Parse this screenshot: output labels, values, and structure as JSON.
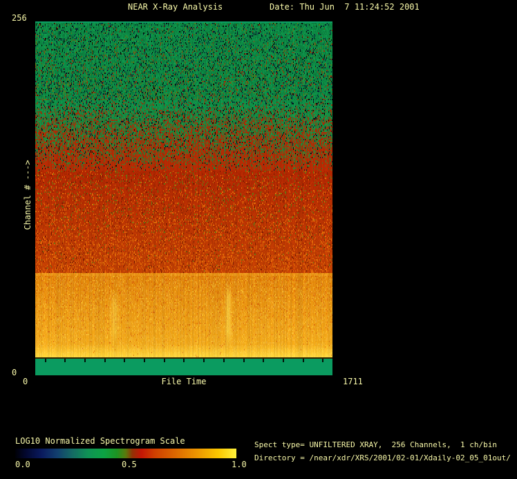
{
  "header": {
    "title": "NEAR X-Ray Analysis",
    "date_label": "Date: Thu Jun  7 11:24:52 2001"
  },
  "axes": {
    "y_max_label": "256",
    "y_min_label": "0",
    "y_axis_label": "Channel # --->",
    "x_min_label": "0",
    "x_max_label": "1711",
    "x_axis_label": "File Time"
  },
  "colorbar": {
    "title": "LOG10 Normalized Spectrogram Scale",
    "tick_labels": [
      "0.0",
      "0.5",
      "1.0"
    ],
    "gradient_stops": [
      {
        "pos": 0.0,
        "color": "#000006"
      },
      {
        "pos": 0.05,
        "color": "#030830"
      },
      {
        "pos": 0.12,
        "color": "#0a1a5e"
      },
      {
        "pos": 0.19,
        "color": "#123f6e"
      },
      {
        "pos": 0.26,
        "color": "#146b63"
      },
      {
        "pos": 0.33,
        "color": "#0f9355"
      },
      {
        "pos": 0.4,
        "color": "#0ca344"
      },
      {
        "pos": 0.46,
        "color": "#1d9422"
      },
      {
        "pos": 0.5,
        "color": "#5a7a0c"
      },
      {
        "pos": 0.53,
        "color": "#933105"
      },
      {
        "pos": 0.57,
        "color": "#c41605"
      },
      {
        "pos": 0.63,
        "color": "#cf3f00"
      },
      {
        "pos": 0.72,
        "color": "#dc6600"
      },
      {
        "pos": 0.82,
        "color": "#ec9500"
      },
      {
        "pos": 0.92,
        "color": "#fbc800"
      },
      {
        "pos": 1.0,
        "color": "#fff23c"
      }
    ]
  },
  "info": {
    "spect_type_line": "Spect type= UNFILTERED XRAY,  256 Channels,  1 ch/bin",
    "directory_line": "Directory = /near/xdr/XRS/2001/02-01/Xdaily-02_05_01out/"
  },
  "colors": {
    "background": "#000000",
    "text": "#f9f9aa"
  },
  "spectrogram_palette": {
    "top_edge": "#0c9e64",
    "green_base": "#0f9a4e",
    "green_dark": "#0a6e35",
    "speck_navy": "#071c38",
    "speck_black": "#041008",
    "speck_red_dim": "#96300a",
    "olive": "#637612",
    "red_base": "#bc2a02",
    "red_bright": "#cc4404",
    "red_dark": "#7c1e02",
    "orange_speck": "#e06a08",
    "boundary_orange": "#f0a428",
    "orange_top": "#e08408",
    "orange_bottom": "#f2ae1c",
    "yellow_edge": "#ffd63c",
    "streak_yellow": "#ffe050",
    "dark_line": "#2e2400",
    "bottom_green": "#0b9b60",
    "tick_black": "#021008"
  },
  "chart_data": {
    "type": "heatmap",
    "title": "NEAR X-Ray Analysis",
    "xlabel": "File Time",
    "ylabel": "Channel #",
    "x_range": [
      0,
      1711
    ],
    "y_range": [
      0,
      256
    ],
    "colorscale_label": "LOG10 Normalized Spectrogram Scale",
    "colorscale_range": [
      0.0,
      1.0
    ],
    "legend_position": "bottom-left",
    "bands": [
      {
        "channel_range": [
          255,
          256
        ],
        "approx_value": 0.4,
        "appearance": "solid teal-green top edge line"
      },
      {
        "channel_range": [
          199,
          256
        ],
        "approx_value": 0.38,
        "appearance": "noisy green with dark navy/black speckles"
      },
      {
        "channel_range": [
          148,
          199
        ],
        "approx_value": 0.5,
        "appearance": "mottled green-to-red transition"
      },
      {
        "channel_range": [
          74,
          148
        ],
        "approx_value": 0.62,
        "appearance": "noisy red-orange"
      },
      {
        "channel_range": [
          13,
          74
        ],
        "approx_value": 0.8,
        "appearance": "bright orange brightening to yellow toward lower channels"
      },
      {
        "channel_range": [
          0,
          13
        ],
        "approx_value": 0.4,
        "appearance": "solid green baseline band with small black tick marks"
      }
    ],
    "features": [
      {
        "type": "vertical-bright-streak",
        "file_time": 455,
        "channel_range": [
          20,
          55
        ],
        "appearance": "faint yellow streak"
      },
      {
        "type": "vertical-bright-streak",
        "file_time": 1110,
        "channel_range": [
          18,
          58
        ],
        "appearance": "yellow streak"
      }
    ]
  }
}
